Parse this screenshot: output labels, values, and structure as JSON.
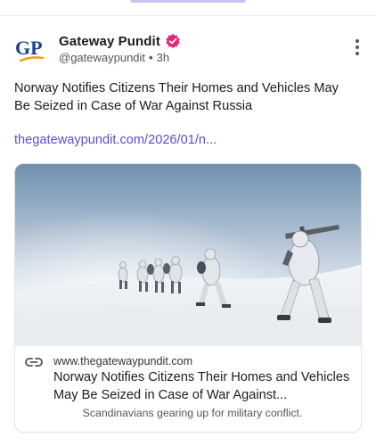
{
  "post": {
    "author_name": "Gateway Pundit",
    "handle": "@gatewaypundit",
    "separator": "•",
    "time": "3h",
    "avatar_text": "GP",
    "text": "Norway Notifies Citizens Their Homes and Vehicles May Be Seized in Case of War Against Russia",
    "link": "thegatewaypundit.com/2026/01/n..."
  },
  "card": {
    "domain": "www.thegatewaypundit.com",
    "title": "Norway Notifies Citizens Their Homes and Vehicles May Be Seized in Case of War Against...",
    "description": "Scandinavians gearing up for military conflict.",
    "image_alt": "Soldiers in white winter camouflage trekking through snow"
  },
  "colors": {
    "link": "#5a4fcf",
    "verified": "#e0287a",
    "avatar_blue": "#1f3f8f",
    "avatar_orange": "#f0a020"
  },
  "icons": {
    "verified": "verified-badge-icon",
    "menu": "more-vertical-icon",
    "link": "link-icon"
  }
}
